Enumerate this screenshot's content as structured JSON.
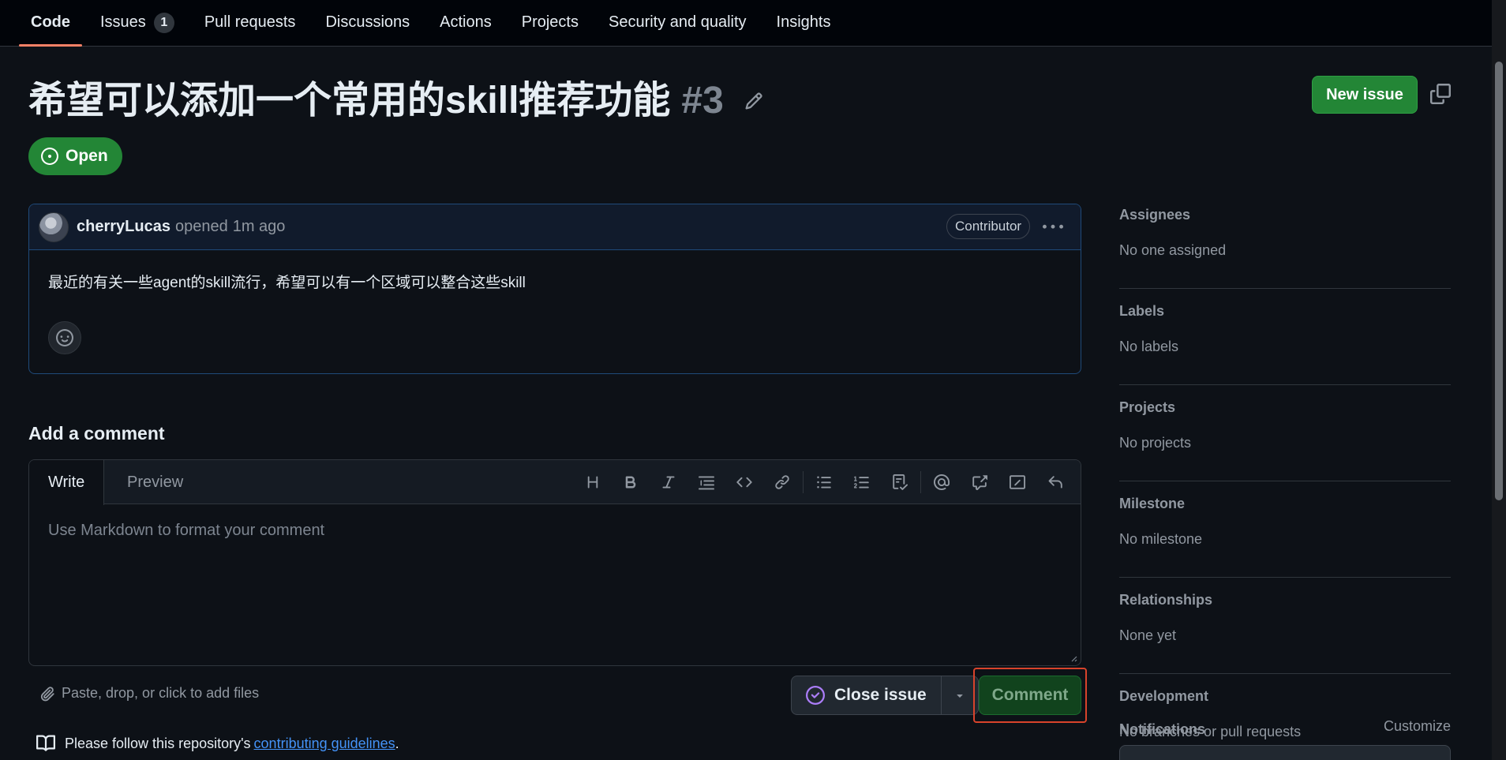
{
  "nav": {
    "tabs": [
      {
        "label": "Code",
        "active": true
      },
      {
        "label": "Issues",
        "count": "1"
      },
      {
        "label": "Pull requests"
      },
      {
        "label": "Discussions"
      },
      {
        "label": "Actions"
      },
      {
        "label": "Projects"
      },
      {
        "label": "Security and quality"
      },
      {
        "label": "Insights"
      }
    ]
  },
  "issue": {
    "title": "希望可以添加一个常用的skill推荐功能",
    "number": "#3",
    "state": "Open",
    "new_issue_label": "New issue"
  },
  "comment": {
    "author": "cherryLucas",
    "action": "opened",
    "time": "1m ago",
    "role": "Contributor",
    "body": "最近的有关一些agent的skill流行，希望可以有一个区域可以整合这些skill"
  },
  "composer": {
    "heading": "Add a comment",
    "tab_write": "Write",
    "tab_preview": "Preview",
    "placeholder": "Use Markdown to format your comment",
    "attach_hint": "Paste, drop, or click to add files",
    "close_issue_label": "Close issue",
    "comment_label": "Comment",
    "guidelines_prefix": "Please follow this repository's",
    "guidelines_link": "contributing guidelines",
    "guidelines_suffix": "."
  },
  "sidebar": {
    "sections": [
      {
        "label": "Assignees",
        "value": "No one assigned"
      },
      {
        "label": "Labels",
        "value": "No labels"
      },
      {
        "label": "Projects",
        "value": "No projects"
      },
      {
        "label": "Milestone",
        "value": "No milestone"
      },
      {
        "label": "Relationships",
        "value": "None yet"
      },
      {
        "label": "Development",
        "value": "No branches or pull requests"
      }
    ],
    "notifications_label": "Notifications",
    "customize_label": "Customize"
  },
  "colors": {
    "background": "#0d1117",
    "accent_green": "#238636",
    "link_blue": "#4493f8",
    "highlight_red": "#d8432b",
    "close_icon_purple": "#ab7df8"
  },
  "icons": [
    "pencil-icon",
    "copy-icon",
    "issue-opened-icon",
    "kebab-horizontal-icon",
    "smiley-icon",
    "heading-icon",
    "bold-icon",
    "italic-icon",
    "quote-icon",
    "code-icon",
    "link-icon",
    "unordered-list-icon",
    "ordered-list-icon",
    "task-list-icon",
    "mention-icon",
    "cross-reference-icon",
    "saved-replies-icon",
    "undo-icon",
    "paperclip-icon",
    "issue-closed-icon",
    "triangle-down-icon",
    "book-icon"
  ]
}
